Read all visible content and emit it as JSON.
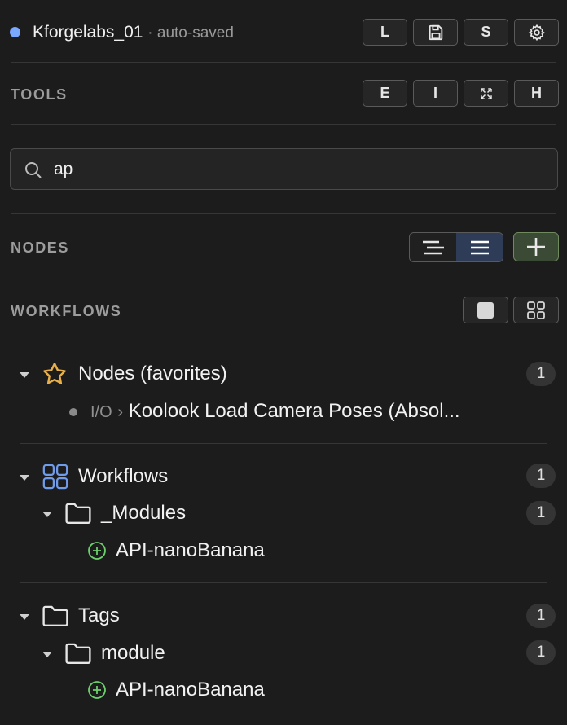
{
  "header": {
    "project_name": "Kforgelabs_01",
    "save_status": "· auto-saved",
    "buttons": {
      "load": "L",
      "save_icon": "floppy-icon",
      "save_as": "S",
      "settings_icon": "gear-icon"
    }
  },
  "tools": {
    "label": "TOOLS",
    "buttons": [
      "E",
      "I",
      "",
      "H"
    ]
  },
  "search": {
    "value": "ap",
    "placeholder": ""
  },
  "nodes": {
    "label": "NODES",
    "view_mode": "list",
    "add_icon": "plus-icon"
  },
  "workflows": {
    "label": "WORKFLOWS"
  },
  "tree": {
    "favorites": {
      "label": "Nodes (favorites)",
      "count": "1",
      "icon": "star-icon",
      "items": [
        {
          "category": "I/O",
          "sep": "›",
          "name": "Koolook Load Camera Poses (Absol..."
        }
      ]
    },
    "workflows": {
      "label": "Workflows",
      "count": "1",
      "icon": "grid-icon",
      "folder": {
        "label": "_Modules",
        "count": "1"
      },
      "item": "API-nanoBanana"
    },
    "tags": {
      "label": "Tags",
      "count": "1",
      "folder": {
        "label": "module",
        "count": "1"
      },
      "item": "API-nanoBanana"
    }
  },
  "colors": {
    "accent_dot": "#7aa7ff",
    "star": "#e8b04a",
    "grid_icon": "#6f9bea",
    "add_green": "#6ccf6c",
    "toggle_active": "#2f3c58"
  }
}
